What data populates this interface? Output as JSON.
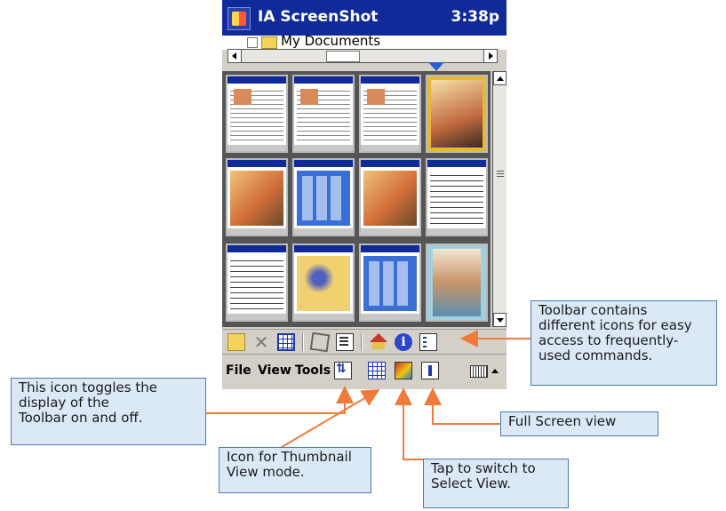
{
  "device": {
    "title": "IA ScreenShot",
    "clock": "3:38p",
    "folder": "My Documents"
  },
  "toolbar": {
    "icons": [
      "new-folder-icon",
      "delete-icon",
      "thumbnail-grid-icon",
      "crop-icon",
      "properties-icon",
      "home-icon",
      "info-icon",
      "list-icon"
    ]
  },
  "menubar": {
    "file": "File",
    "view": "View",
    "tools": "Tools"
  },
  "callouts": {
    "toolbar": "Toolbar contains\ndifferent icons for easy\naccess to frequently-\nused commands.",
    "toggle": "This icon toggles the\ndisplay of the\nToolbar on and off.",
    "fullscreen": "Full Screen view",
    "thumbnail": "Icon for Thumbnail\nView mode.",
    "select": "Tap to switch to\nSelect View."
  },
  "colors": {
    "titlebar": "#102a9a",
    "callout_bg": "#dbe9f7",
    "callout_border": "#4b7bb0",
    "arrow": "#f07a3a"
  }
}
